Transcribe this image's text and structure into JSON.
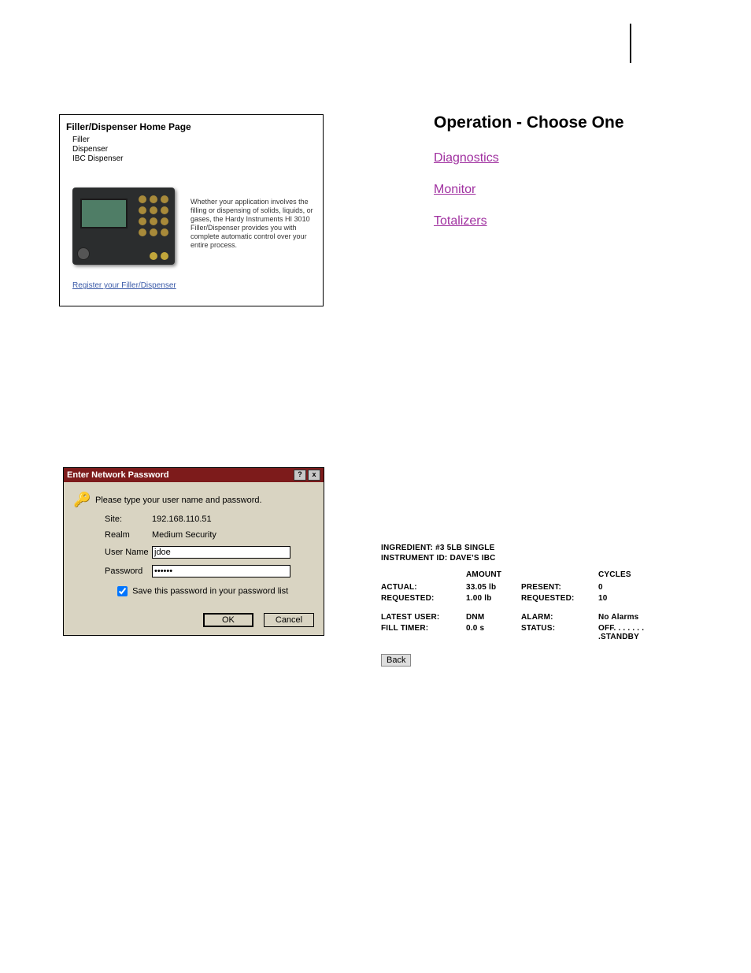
{
  "homecard": {
    "title": "Filler/Dispenser Home Page",
    "items": [
      "Filler",
      "Dispenser",
      "IBC Dispenser"
    ],
    "blurb": "Whether your application involves the filling or dispensing of solids, liquids, or gases, the Hardy Instruments HI 3010 Filler/Dispenser provides you with complete automatic control over your entire process.",
    "register_link": "Register your Filler/Dispenser"
  },
  "operation": {
    "title": "Operation - Choose One",
    "links": [
      "Diagnostics",
      "Monitor",
      "Totalizers"
    ]
  },
  "dialog": {
    "title": "Enter Network Password",
    "instruction": "Please type your user name and password.",
    "site_label": "Site:",
    "site_value": "192.168.110.51",
    "realm_label": "Realm",
    "realm_value": "Medium Security",
    "user_label": "User Name",
    "user_value": "jdoe",
    "pass_label": "Password",
    "pass_value": "••••••",
    "save_label": "Save this password in your password list",
    "ok_label": "OK",
    "cancel_label": "Cancel"
  },
  "monitor_panel": {
    "ingredient_label": "INGREDIENT:",
    "ingredient_value": "#3 5LB SINGLE",
    "instrument_label": "INSTRUMENT ID:",
    "instrument_value": "DAVE'S IBC",
    "col_amount": "AMOUNT",
    "col_cycles": "CYCLES",
    "actual_label": "ACTUAL:",
    "actual_value": "33.05 lb",
    "present_label": "PRESENT:",
    "present_value": "0",
    "req_label": "REQUESTED:",
    "req_value": "1.00 lb",
    "req2_label": "REQUESTED:",
    "req2_value": "10",
    "latest_label": "LATEST USER:",
    "latest_value": "DNM",
    "alarm_label": "ALARM:",
    "alarm_value": "No Alarms",
    "fill_label": "FILL TIMER:",
    "fill_value": "0.0 s",
    "status_label": "STATUS:",
    "status_value": "OFF. . . . . . . .STANDBY",
    "back_label": "Back"
  }
}
